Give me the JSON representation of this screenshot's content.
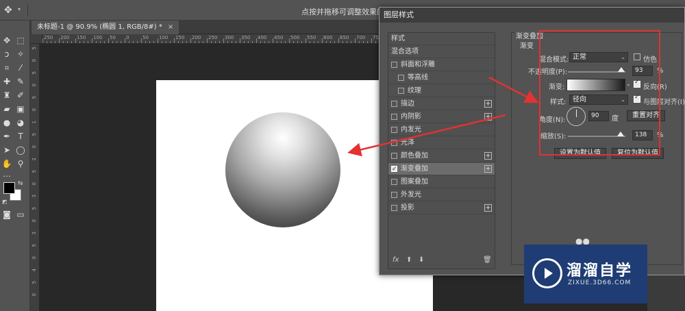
{
  "optionsbar": {
    "move_icon": "move-icon",
    "hint": "点按并拖移可调整效果的位置"
  },
  "document": {
    "tab_label": "未标题-1 @ 90.9% (椭圆 1, RGB/8#) *",
    "close": "×"
  },
  "rulers": {
    "h_ticks": [
      "250",
      "200",
      "150",
      "100",
      "50",
      "0",
      "50",
      "100",
      "150",
      "200",
      "250",
      "300",
      "350",
      "400",
      "450",
      "500",
      "550",
      "600",
      "650",
      "700",
      "750"
    ],
    "v_ticks": [
      "5",
      "0",
      "5",
      "0",
      "5",
      "0",
      "1",
      "5",
      "0",
      "2",
      "5",
      "0",
      "3",
      "5",
      "0",
      "3",
      "5",
      "0",
      "4",
      "5",
      "0"
    ]
  },
  "dialog": {
    "title": "图层样式",
    "styles_list": [
      {
        "label": "样式",
        "checkbox": false,
        "plus": false,
        "indent": 0
      },
      {
        "label": "混合选项",
        "checkbox": false,
        "plus": false,
        "indent": 0
      },
      {
        "label": "斜面和浮雕",
        "checkbox": true,
        "checked": false,
        "plus": false,
        "indent": 0
      },
      {
        "label": "等高线",
        "checkbox": true,
        "checked": false,
        "plus": false,
        "indent": 1
      },
      {
        "label": "纹理",
        "checkbox": true,
        "checked": false,
        "plus": false,
        "indent": 1
      },
      {
        "label": "描边",
        "checkbox": true,
        "checked": false,
        "plus": true,
        "indent": 0
      },
      {
        "label": "内阴影",
        "checkbox": true,
        "checked": false,
        "plus": true,
        "indent": 0
      },
      {
        "label": "内发光",
        "checkbox": true,
        "checked": false,
        "plus": false,
        "indent": 0
      },
      {
        "label": "光泽",
        "checkbox": true,
        "checked": false,
        "plus": false,
        "indent": 0
      },
      {
        "label": "颜色叠加",
        "checkbox": true,
        "checked": false,
        "plus": true,
        "indent": 0
      },
      {
        "label": "渐变叠加",
        "checkbox": true,
        "checked": true,
        "plus": true,
        "indent": 0,
        "selected": true
      },
      {
        "label": "图案叠加",
        "checkbox": true,
        "checked": false,
        "plus": false,
        "indent": 0
      },
      {
        "label": "外发光",
        "checkbox": true,
        "checked": false,
        "plus": false,
        "indent": 0
      },
      {
        "label": "投影",
        "checkbox": true,
        "checked": false,
        "plus": true,
        "indent": 0
      }
    ],
    "fx": "fx",
    "panel": {
      "group_title": "渐变叠加",
      "sub_title": "渐变",
      "blend_mode_label": "混合模式:",
      "blend_mode_value": "正常",
      "dither_label": "仿色",
      "opacity_label": "不透明度(P):",
      "opacity_value": "93",
      "opacity_unit": "%",
      "gradient_label": "渐变:",
      "reverse_label": "反向(R)",
      "style_label": "样式:",
      "style_value": "径向",
      "align_label": "与图层对齐(I)",
      "angle_label": "角度(N):",
      "angle_value": "90",
      "angle_unit": "度",
      "reset_align_button": "重置对齐",
      "scale_label": "缩放(S):",
      "scale_value": "138",
      "scale_unit": "%",
      "set_default_button": "设置为默认值",
      "reset_default_button": "复位为默认值",
      "opacity_level": 0.93,
      "scale_level": 0.92
    }
  },
  "watermark": {
    "brand_cn": "溜溜自学",
    "brand_en": "ZIXUE.3D66.COM"
  },
  "colors": {
    "accent_red": "#e23232",
    "watermark_blue": "#1f3d74"
  }
}
